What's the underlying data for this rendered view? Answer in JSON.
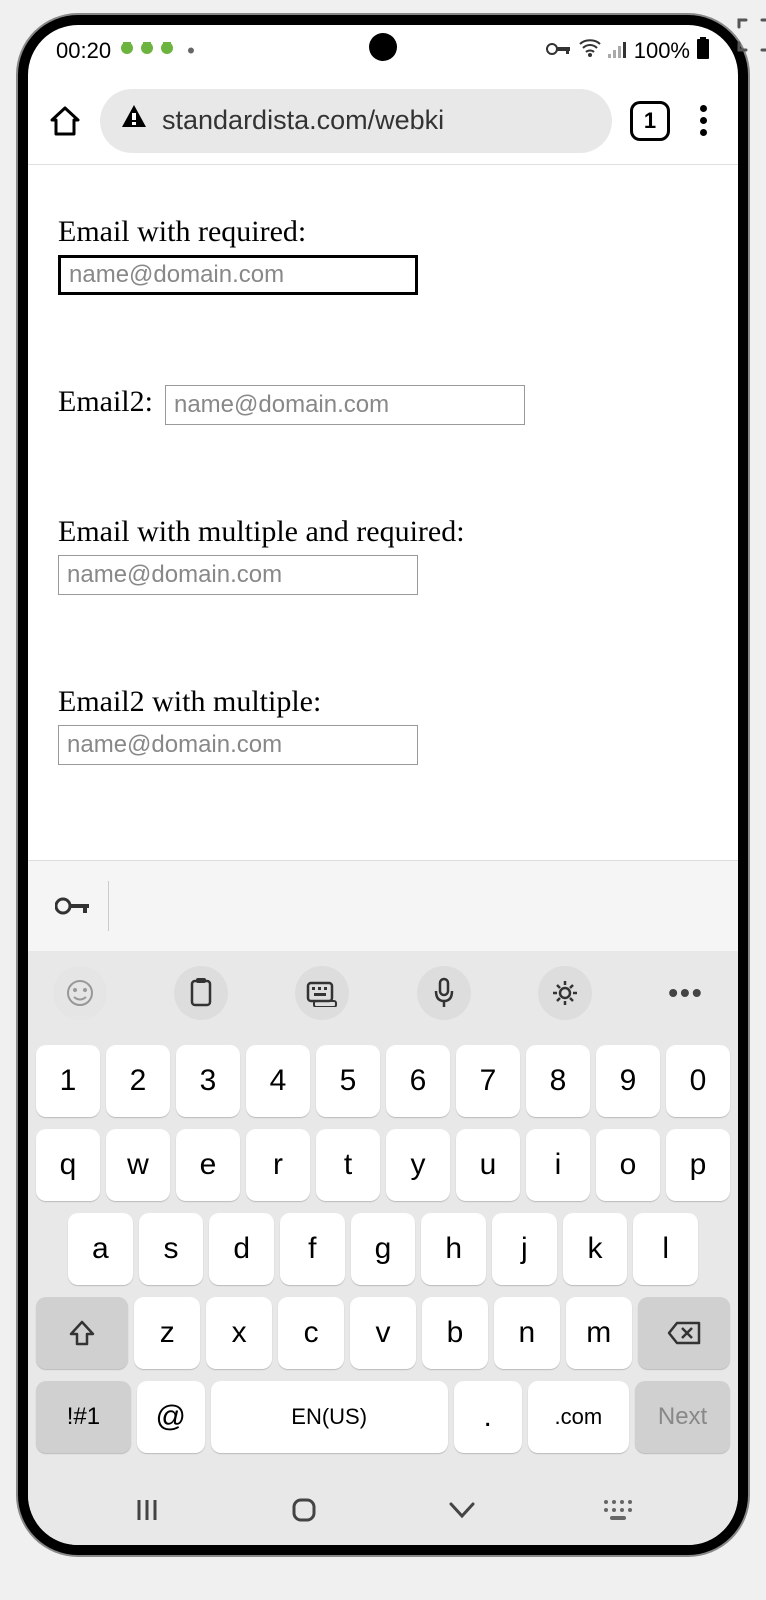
{
  "status_bar": {
    "time": "00:20",
    "battery_text": "100%"
  },
  "browser": {
    "url": "standardista.com/webki",
    "tab_count": "1"
  },
  "form": {
    "fields": [
      {
        "label": "Email with required:",
        "placeholder": "name@domain.com"
      },
      {
        "label": "Email2:",
        "placeholder": "name@domain.com"
      },
      {
        "label": "Email with multiple and required:",
        "placeholder": "name@domain.com"
      },
      {
        "label": "Email2 with multiple:",
        "placeholder": "name@domain.com"
      }
    ]
  },
  "keyboard": {
    "row1": [
      "1",
      "2",
      "3",
      "4",
      "5",
      "6",
      "7",
      "8",
      "9",
      "0"
    ],
    "row2": [
      "q",
      "w",
      "e",
      "r",
      "t",
      "y",
      "u",
      "i",
      "o",
      "p"
    ],
    "row3": [
      "a",
      "s",
      "d",
      "f",
      "g",
      "h",
      "j",
      "k",
      "l"
    ],
    "row4": [
      "z",
      "x",
      "c",
      "v",
      "b",
      "n",
      "m"
    ],
    "bottom": {
      "symbols": "!#1",
      "at": "@",
      "space": "EN(US)",
      "period": ".",
      "com": ".com",
      "next": "Next"
    }
  }
}
